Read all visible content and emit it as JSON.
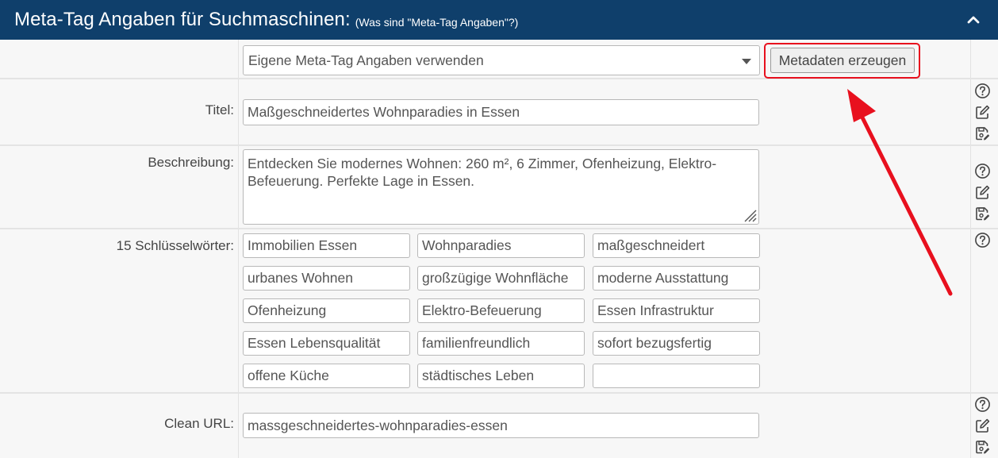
{
  "header": {
    "title": "Meta-Tag Angaben für Suchmaschinen:",
    "subtitle": "(Was sind \"Meta-Tag Angaben\"?)"
  },
  "mode_select": {
    "value": "Eigene Meta-Tag Angaben verwenden"
  },
  "generate_button": {
    "label": "Metadaten erzeugen"
  },
  "title_field": {
    "label": "Titel:",
    "value": "Maßgeschneidertes Wohnparadies in Essen"
  },
  "description_field": {
    "label": "Beschreibung:",
    "value": "Entdecken Sie modernes Wohnen: 260 m², 6 Zimmer, Ofenheizung, Elektro-Befeuerung. Perfekte Lage in Essen."
  },
  "keywords": {
    "label": "15 Schlüsselwörter:",
    "items": [
      "Immobilien Essen",
      "Wohnparadies",
      "maßgeschneidert",
      "urbanes Wohnen",
      "großzügige Wohnfläche",
      "moderne Ausstattung",
      "Ofenheizung",
      "Elektro-Befeuerung",
      "Essen Infrastruktur",
      "Essen Lebensqualität",
      "familienfreundlich",
      "sofort bezugsfertig",
      "offene Küche",
      "städtisches Leben",
      ""
    ]
  },
  "clean_url_field": {
    "label": "Clean URL:",
    "value": "massgeschneidertes-wohnparadies-essen"
  },
  "icons": {
    "help": "question-circle-icon",
    "edit": "pencil-square-icon",
    "save": "floppy-disk-edit-icon",
    "collapse": "chevron-up-icon"
  },
  "colors": {
    "header_bg": "#0f3f6b",
    "highlight": "#e8101e",
    "arrow": "#e8101e"
  }
}
